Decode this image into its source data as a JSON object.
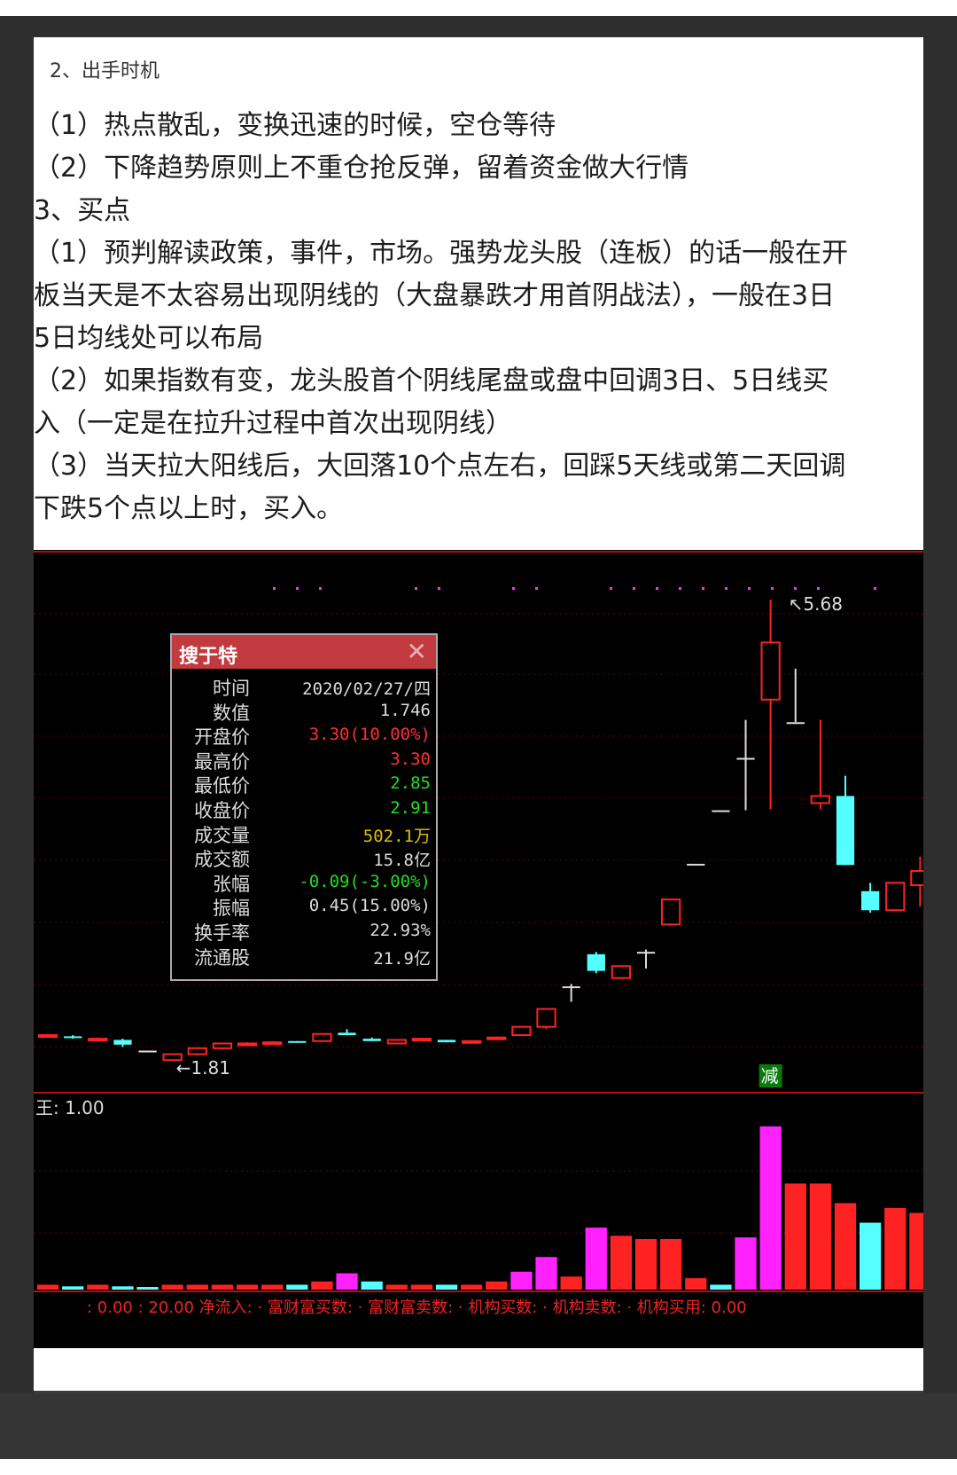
{
  "text": {
    "heading": "2、出手时机",
    "lines": [
      "（1）热点散乱，变换迅速的时候，空仓等待",
      "（2）下降趋势原则上不重仓抢反弹，留着资金做大行情",
      "3、买点",
      "（1）预判解读政策，事件，市场。强势龙头股（连板）的话一般在开",
      "板当天是不太容易出现阴线的（大盘暴跌才用首阴战法），一般在3日",
      "5日均线处可以布局",
      "（2）如果指数有变，龙头股首个阴线尾盘或盘中回调3日、5日线买",
      "入（一定是在拉升过程中首次出现阴线）",
      "（3）当天拉大阳线后，大回落10个点左右，回踩5天线或第二天回调",
      "下跌5个点以上时，买入。"
    ]
  },
  "tooltip": {
    "title": "搜于特",
    "close": "✕",
    "rows": [
      {
        "label": "时间",
        "value": "2020/02/27/四",
        "color": "#dcdcdc"
      },
      {
        "label": "数值",
        "value": "1.746",
        "color": "#dcdcdc"
      },
      {
        "label": "开盘价",
        "value": "3.30(10.00%)",
        "color": "#ff3030"
      },
      {
        "label": "最高价",
        "value": "3.30",
        "color": "#ff3030"
      },
      {
        "label": "最低价",
        "value": "2.85",
        "color": "#22dd22"
      },
      {
        "label": "收盘价",
        "value": "2.91",
        "color": "#22dd22"
      },
      {
        "label": "成交量",
        "value": "502.1万",
        "color": "#e0c000"
      },
      {
        "label": "成交额",
        "value": "15.8亿",
        "color": "#dcdcdc"
      },
      {
        "label": "张幅",
        "value": "-0.09(-3.00%)",
        "color": "#22dd22"
      },
      {
        "label": "振幅",
        "value": "0.45(15.00%)",
        "color": "#dcdcdc"
      },
      {
        "label": "换手率",
        "value": "22.93%",
        "color": "#dcdcdc"
      },
      {
        "label": "流通股",
        "value": "21.9亿",
        "color": "#dcdcdc"
      }
    ]
  },
  "chart_labels": {
    "high_marker": "5.68",
    "low_marker": "1.81",
    "reduce_tag": "减",
    "indicator_label": "王: 1.00",
    "bottom_bar": ": 0.00  : 20.00  净流入: · 富财富买数: · 富财富卖数: · 机构买数: · 机构卖数: · 机构买用: 0.00"
  },
  "chart_data": {
    "type": "candlestick",
    "candles": [
      {
        "o": 2.02,
        "c": 2.02,
        "h": 2.03,
        "l": 2.01,
        "up": true
      },
      {
        "o": 2.01,
        "c": 2.0,
        "h": 2.02,
        "l": 1.99,
        "up": false
      },
      {
        "o": 1.99,
        "c": 1.99,
        "h": 2.0,
        "l": 1.98,
        "up": true
      },
      {
        "o": 1.98,
        "c": 1.94,
        "h": 1.99,
        "l": 1.92,
        "up": false
      },
      {
        "o": 1.89,
        "c": 1.89,
        "h": 1.89,
        "l": 1.89,
        "up": false,
        "doji": true
      },
      {
        "o": 1.81,
        "c": 1.86,
        "h": 1.86,
        "l": 1.81,
        "up": true
      },
      {
        "o": 1.86,
        "c": 1.91,
        "h": 1.91,
        "l": 1.85,
        "up": true
      },
      {
        "o": 1.91,
        "c": 1.95,
        "h": 1.95,
        "l": 1.9,
        "up": true
      },
      {
        "o": 1.95,
        "c": 1.95,
        "h": 1.96,
        "l": 1.94,
        "up": true
      },
      {
        "o": 1.96,
        "c": 1.96,
        "h": 1.97,
        "l": 1.95,
        "up": true
      },
      {
        "o": 1.97,
        "c": 1.96,
        "h": 1.97,
        "l": 1.96,
        "up": false
      },
      {
        "o": 1.97,
        "c": 2.03,
        "h": 2.03,
        "l": 1.97,
        "up": true
      },
      {
        "o": 2.04,
        "c": 2.02,
        "h": 2.07,
        "l": 2.02,
        "up": false
      },
      {
        "o": 1.99,
        "c": 1.97,
        "h": 2.0,
        "l": 1.97,
        "up": false
      },
      {
        "o": 1.95,
        "c": 1.98,
        "h": 1.98,
        "l": 1.95,
        "up": true
      },
      {
        "o": 1.98,
        "c": 1.99,
        "h": 1.99,
        "l": 1.98,
        "up": true
      },
      {
        "o": 1.98,
        "c": 1.96,
        "h": 1.98,
        "l": 1.96,
        "up": false
      },
      {
        "o": 1.96,
        "c": 1.97,
        "h": 1.97,
        "l": 1.95,
        "up": true
      },
      {
        "o": 1.99,
        "c": 2.0,
        "h": 2.01,
        "l": 1.98,
        "up": true
      },
      {
        "o": 2.02,
        "c": 2.09,
        "h": 2.09,
        "l": 2.02,
        "up": true
      },
      {
        "o": 2.09,
        "c": 2.24,
        "h": 2.24,
        "l": 2.07,
        "up": true
      },
      {
        "o": 2.43,
        "c": 2.43,
        "h": 2.45,
        "l": 2.3,
        "up": false,
        "doji": true
      },
      {
        "o": 2.7,
        "c": 2.56,
        "h": 2.72,
        "l": 2.54,
        "up": false
      },
      {
        "o": 2.5,
        "c": 2.6,
        "h": 2.6,
        "l": 2.5,
        "up": true
      },
      {
        "o": 2.72,
        "c": 2.72,
        "h": 2.74,
        "l": 2.58,
        "up": false,
        "doji": true
      },
      {
        "o": 2.95,
        "c": 3.16,
        "h": 3.16,
        "l": 2.94,
        "up": true
      },
      {
        "o": 3.46,
        "c": 3.46,
        "h": 3.46,
        "l": 3.46,
        "up": false,
        "doji": true
      },
      {
        "o": 3.91,
        "c": 3.91,
        "h": 3.91,
        "l": 3.91,
        "up": false,
        "doji": true
      },
      {
        "o": 4.35,
        "c": 4.35,
        "h": 4.67,
        "l": 3.91,
        "up": false,
        "doji": true
      },
      {
        "o": 4.84,
        "c": 5.32,
        "h": 5.68,
        "l": 3.92,
        "up": true
      },
      {
        "o": 4.65,
        "c": 4.65,
        "h": 5.1,
        "l": 4.65,
        "up": false,
        "doji": true
      },
      {
        "o": 3.97,
        "c": 4.03,
        "h": 4.67,
        "l": 3.92,
        "up": true
      },
      {
        "o": 4.03,
        "c": 3.45,
        "h": 4.2,
        "l": 3.45,
        "up": false
      },
      {
        "o": 3.23,
        "c": 3.07,
        "h": 3.3,
        "l": 3.05,
        "up": false
      },
      {
        "o": 3.07,
        "c": 3.3,
        "h": 3.3,
        "l": 3.07,
        "up": true
      },
      {
        "o": 3.28,
        "c": 3.4,
        "h": 3.52,
        "l": 3.1,
        "up": true
      }
    ],
    "indicator_values": [
      0.03,
      0.02,
      0.03,
      0.02,
      0.01,
      0.03,
      0.03,
      0.03,
      0.03,
      0.03,
      0.03,
      0.05,
      0.1,
      0.05,
      0.03,
      0.03,
      0.03,
      0.03,
      0.05,
      0.11,
      0.2,
      0.08,
      0.38,
      0.33,
      0.31,
      0.31,
      0.07,
      0.03,
      0.32,
      1.0,
      0.65,
      0.65,
      0.53,
      0.41,
      0.5,
      0.47
    ],
    "indicator_colors": [
      "#ff2222",
      "#55ffff",
      "#ff2222",
      "#55ffff",
      "#55ffff",
      "#ff2222",
      "#ff2222",
      "#ff2222",
      "#ff2222",
      "#ff2222",
      "#55ffff",
      "#ff2222",
      "#ff22ff",
      "#55ffff",
      "#ff2222",
      "#ff2222",
      "#55ffff",
      "#ff2222",
      "#ff2222",
      "#ff22ff",
      "#ff22ff",
      "#ff2222",
      "#ff22ff",
      "#ff2222",
      "#ff2222",
      "#ff2222",
      "#ff2222",
      "#55ffff",
      "#ff22ff",
      "#ff22ff",
      "#ff2222",
      "#ff2222",
      "#ff2222",
      "#55ffff",
      "#ff2222",
      "#ff2222"
    ],
    "ylim": [
      1.7,
      5.8
    ],
    "up_color": "#ff2222",
    "down_color": "#55ffff",
    "doji_color": "#dddddd"
  }
}
